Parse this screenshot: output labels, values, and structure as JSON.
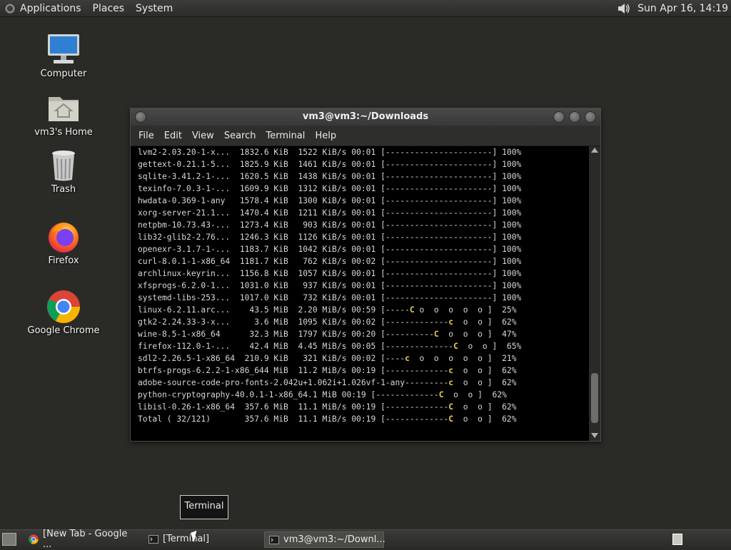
{
  "top_panel": {
    "menus": [
      "Applications",
      "Places",
      "System"
    ],
    "clock": "Sun Apr 16, 14:19"
  },
  "desktop": {
    "icons": [
      {
        "label": "Computer",
        "icon": "computer-icon"
      },
      {
        "label": "vm3's Home",
        "icon": "home-folder-icon"
      },
      {
        "label": "Trash",
        "icon": "trash-icon"
      },
      {
        "label": "Firefox",
        "icon": "firefox-icon"
      },
      {
        "label": "Google Chrome",
        "icon": "chrome-icon"
      }
    ]
  },
  "terminal": {
    "title": "vm3@vm3:~/Downloads",
    "menu": [
      "File",
      "Edit",
      "View",
      "Search",
      "Terminal",
      "Help"
    ],
    "lines": [
      {
        "text": "lvm2-2.03.20-1-x...  1832.6 KiB  1522 KiB/s 00:01 [----------------------] 100%"
      },
      {
        "text": "gettext-0.21.1-5...  1825.9 KiB  1461 KiB/s 00:01 [----------------------] 100%"
      },
      {
        "text": "sqlite-3.41.2-1-...  1620.5 KiB  1438 KiB/s 00:01 [----------------------] 100%"
      },
      {
        "text": "texinfo-7.0.3-1-...  1609.9 KiB  1312 KiB/s 00:01 [----------------------] 100%"
      },
      {
        "text": "hwdata-0.369-1-any   1578.4 KiB  1300 KiB/s 00:01 [----------------------] 100%"
      },
      {
        "text": "xorg-server-21.1...  1470.4 KiB  1211 KiB/s 00:01 [----------------------] 100%"
      },
      {
        "text": "netpbm-10.73.43-...  1273.4 KiB   903 KiB/s 00:01 [----------------------] 100%"
      },
      {
        "text": "lib32-glib2-2.76...  1246.3 KiB  1126 KiB/s 00:01 [----------------------] 100%"
      },
      {
        "text": "openexr-3.1.7-1-...  1183.7 KiB  1042 KiB/s 00:01 [----------------------] 100%"
      },
      {
        "text": "curl-8.0.1-1-x86_64  1181.7 KiB   762 KiB/s 00:02 [----------------------] 100%"
      },
      {
        "text": "archlinux-keyrin...  1156.8 KiB  1057 KiB/s 00:01 [----------------------] 100%"
      },
      {
        "text": "xfsprogs-6.2.0-1...  1031.0 KiB   937 KiB/s 00:01 [----------------------] 100%"
      },
      {
        "text": "systemd-libs-253...  1017.0 KiB   732 KiB/s 00:01 [----------------------] 100%"
      },
      {
        "pre": "linux-6.2.11.arc...    43.5 MiB  2.20 MiB/s 00:59 [-----",
        "pac": "C",
        "post": " o  o  o  o  o ]  25%"
      },
      {
        "pre": "gtk2-2.24.33-3-x...     3.6 MiB  1095 KiB/s 00:02 [-------------",
        "pac": "c",
        "post": "  o  o ]  62%"
      },
      {
        "pre": "wine-8.5-1-x86_64      32.3 MiB  1797 KiB/s 00:20 [----------",
        "pac": "C",
        "post": "  o  o  o ]  47%"
      },
      {
        "pre": "firefox-112.0-1-...    42.4 MiB  4.45 MiB/s 00:05 [--------------",
        "pac": "C",
        "post": "  o  o ]  65%"
      },
      {
        "pre": "sdl2-2.26.5-1-x86_64  210.9 KiB   321 KiB/s 00:02 [----",
        "pac": "c",
        "post": "  o  o  o  o  o ]  21%"
      },
      {
        "pre": "btrfs-progs-6.2.2-1-x86_644 MiB  11.2 MiB/s 00:19 [-------------",
        "pac": "c",
        "post": "  o  o ]  62%"
      },
      {
        "pre": "adobe-source-code-pro-fonts-2.042u+1.062i+1.026vf-1-any---------",
        "pac": "c",
        "post": "  o  o ]  62%"
      },
      {
        "pre": "python-cryptography-40.0.1-1-x86_64.1 MiB 00:19 [-------------",
        "pac": "C",
        "post": "  o  o ]  62%"
      },
      {
        "pre": "libisl-0.26-1-x86_64  357.6 MiB  11.1 MiB/s 00:19 [-------------",
        "pac": "C",
        "post": "  o  o ]  62%"
      },
      {
        "pre": "Total ( 32/121)       357.6 MiB  11.1 MiB/s 00:19 [-------------",
        "pac": "C",
        "post": "  o  o ]  62%"
      }
    ]
  },
  "tooltip": {
    "text": "Terminal"
  },
  "taskbar": {
    "items": [
      {
        "label": "[New Tab - Google ...",
        "icon": "chrome-icon",
        "active": false
      },
      {
        "label": "[Terminal]",
        "icon": "terminal-icon",
        "active": false
      },
      {
        "label": "vm3@vm3:~/Downl...",
        "icon": "terminal-icon",
        "active": true
      }
    ]
  },
  "colors": {
    "desktop_bg": "#2a2b27",
    "terminal_bg": "#000000",
    "terminal_fg": "#d8d8d8",
    "pacman_yellow": "#e6d24a"
  }
}
